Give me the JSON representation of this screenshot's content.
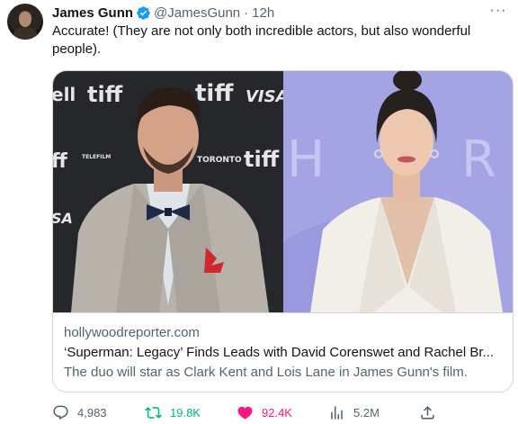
{
  "tweet": {
    "author_name": "James Gunn",
    "handle": "@JamesGunn",
    "separator": "·",
    "time": "12h",
    "more_label": "···",
    "text": "Accurate! (They are not only both incredible actors, but also wonderful people)."
  },
  "card": {
    "backdrop_left": [
      "ell",
      "tiff",
      "tiff",
      "VISA",
      "ff",
      "TELEFILM",
      "TORONTO",
      "tiff",
      "SA"
    ],
    "backdrop_right": [
      "H",
      "R"
    ],
    "domain": "hollywoodreporter.com",
    "title": "‘Superman: Legacy’ Finds Leads with David Corenswet and Rachel Br...",
    "description": "The duo will star as Clark Kent and Lois Lane in James Gunn's film."
  },
  "actions": {
    "replies": "4,983",
    "reposts": "19.8K",
    "likes": "92.4K",
    "views": "5.2M"
  },
  "colors": {
    "verified": "#1d9bf0",
    "retweet": "#00ba7c",
    "like": "#f91880",
    "muted": "#536471"
  },
  "icons": [
    "verified-badge-icon",
    "more-icon",
    "reply-icon",
    "retweet-icon",
    "like-icon",
    "views-icon",
    "share-icon"
  ]
}
